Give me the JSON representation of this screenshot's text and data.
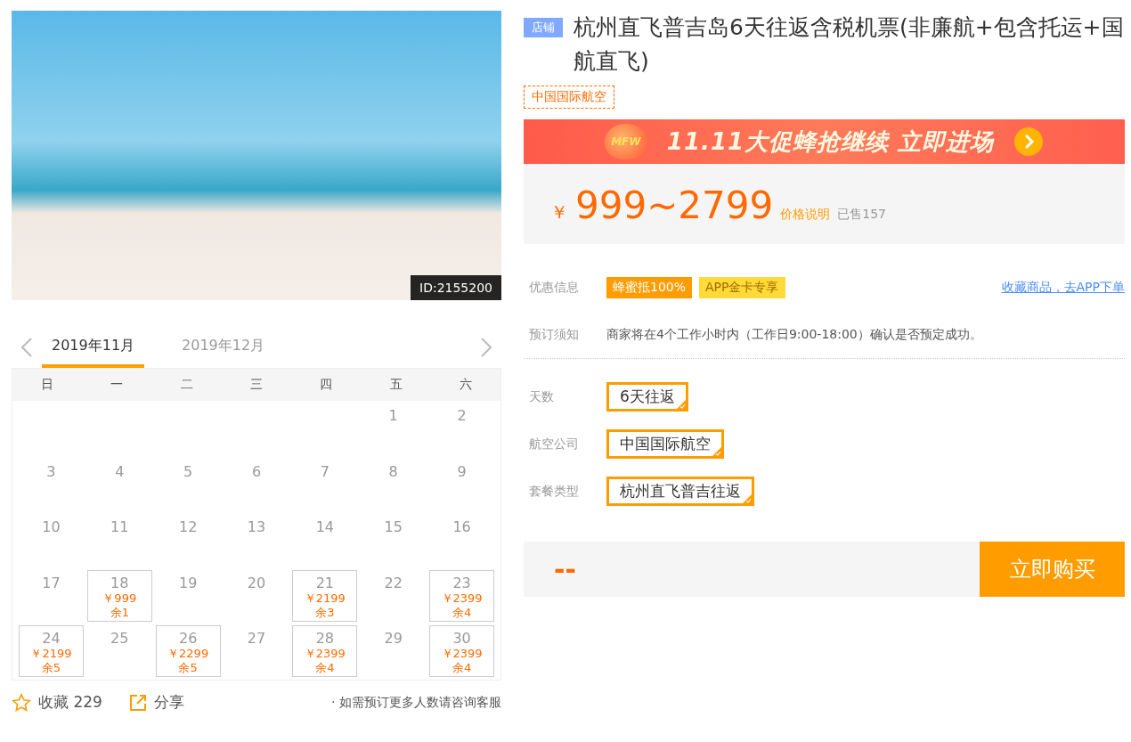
{
  "photo": {
    "id_label": "ID:2155200"
  },
  "calendar": {
    "months": [
      {
        "label": "2019年11月",
        "selected": true
      },
      {
        "label": "2019年12月",
        "selected": false
      }
    ],
    "weekdays": [
      "日",
      "一",
      "二",
      "三",
      "四",
      "五",
      "六"
    ],
    "weeks": [
      [
        {
          "day": "1"
        },
        {
          "day": "2"
        }
      ],
      [
        {
          "day": "3"
        },
        {
          "day": "4"
        },
        {
          "day": "5"
        },
        {
          "day": "6"
        },
        {
          "day": "7"
        },
        {
          "day": "8"
        },
        {
          "day": "9"
        }
      ],
      [
        {
          "day": "10"
        },
        {
          "day": "11"
        },
        {
          "day": "12"
        },
        {
          "day": "13"
        },
        {
          "day": "14"
        },
        {
          "day": "15"
        },
        {
          "day": "16"
        }
      ],
      [
        {
          "day": "17"
        },
        {
          "day": "18",
          "price": "￥999",
          "stock": "余1"
        },
        {
          "day": "19"
        },
        {
          "day": "20"
        },
        {
          "day": "21",
          "price": "￥2199",
          "stock": "余3"
        },
        {
          "day": "22"
        },
        {
          "day": "23",
          "price": "￥2399",
          "stock": "余4"
        }
      ],
      [
        {
          "day": "24",
          "price": "￥2199",
          "stock": "余5"
        },
        {
          "day": "25"
        },
        {
          "day": "26",
          "price": "￥2299",
          "stock": "余5"
        },
        {
          "day": "27"
        },
        {
          "day": "28",
          "price": "￥2399",
          "stock": "余4"
        },
        {
          "day": "29"
        },
        {
          "day": "30",
          "price": "￥2399",
          "stock": "余4"
        }
      ]
    ]
  },
  "footer": {
    "favorite": "收藏 229",
    "share": "分享",
    "note": "· 如需预订更多人数请咨询客服"
  },
  "product": {
    "badge": "店铺",
    "title": "杭州直飞普吉岛6天往返含税机票(非廉航+包含托运+国航直飞)",
    "airline_tag": "中国国际航空"
  },
  "banner": {
    "logo": "MFW",
    "text": "11.11大促蜂抢继续 立即进场"
  },
  "price": {
    "currency": "￥",
    "range": "999~2799",
    "note": "价格说明",
    "sold": "已售157"
  },
  "promo": {
    "label": "优惠信息",
    "tags": [
      {
        "text": "蜂蜜抵100%",
        "kind": "solid"
      },
      {
        "text": "APP金卡专享",
        "kind": "light"
      }
    ],
    "link": "收藏商品，去APP下单"
  },
  "notice": {
    "label": "预订须知",
    "text": "商家将在4个工作小时内（工作日9:00-18:00）确认是否预定成功。"
  },
  "options": [
    {
      "label": "天数",
      "choices": [
        {
          "text": "6天往返",
          "selected": true
        }
      ]
    },
    {
      "label": "航空公司",
      "choices": [
        {
          "text": "中国国际航空",
          "selected": true
        }
      ]
    },
    {
      "label": "套餐类型",
      "choices": [
        {
          "text": "杭州直飞普吉往返",
          "selected": true
        }
      ]
    }
  ],
  "buy_bar": {
    "total": "--",
    "button": "立即购买"
  }
}
